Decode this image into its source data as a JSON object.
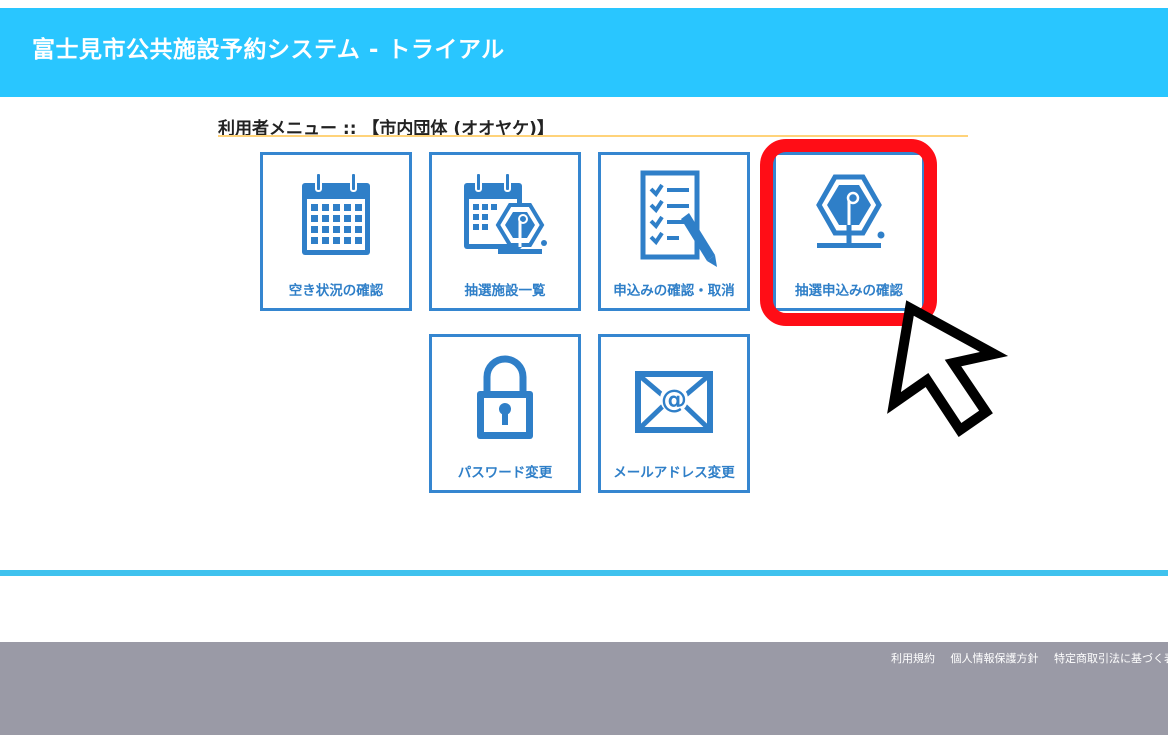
{
  "header": {
    "title": "富士見市公共施設予約システム - トライアル"
  },
  "menu": {
    "heading": "利用者メニュー :: 【市内団体 (オオヤケ)】",
    "tiles": [
      {
        "label": "空き状況の確認",
        "icon": "calendar-icon"
      },
      {
        "label": "抽選施設一覧",
        "icon": "calendar-lottery-icon"
      },
      {
        "label": "申込みの確認・取消",
        "icon": "checklist-pen-icon"
      },
      {
        "label": "抽選申込みの確認",
        "icon": "lottery-machine-icon"
      },
      {
        "label": "パスワード変更",
        "icon": "padlock-icon"
      },
      {
        "label": "メールアドレス変更",
        "icon": "mail-at-icon"
      }
    ]
  },
  "annotation": {
    "highlight_color": "#ff0d16",
    "pointer_icon": "cursor-arrow-icon"
  },
  "footer": {
    "links": [
      "利用規約",
      "個人情報保護方針",
      "特定商取引法に基づく表記"
    ]
  },
  "colors": {
    "header": "#29c6ff",
    "tile_accent": "#3586d0",
    "footer": "#9a9aa6"
  }
}
